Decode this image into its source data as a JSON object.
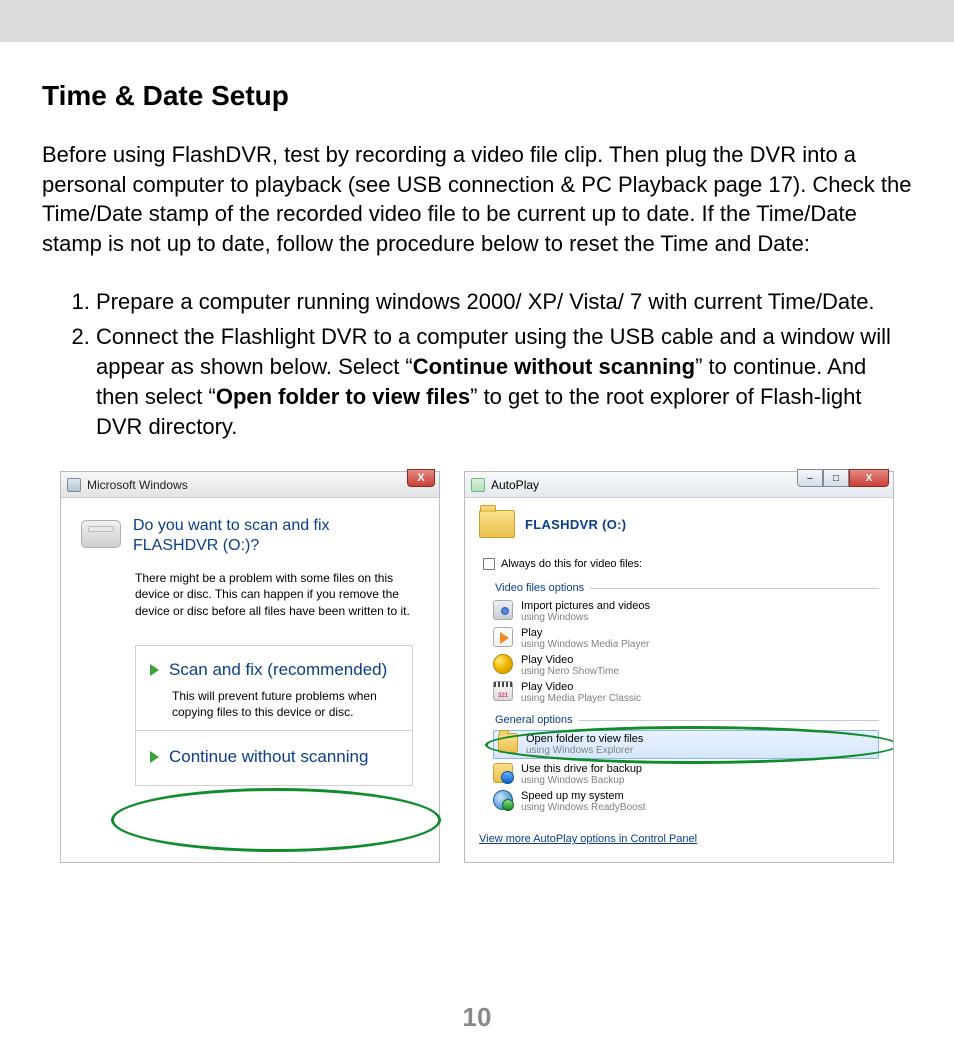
{
  "title": "Time & Date Setup",
  "intro": "Before using FlashDVR, test by recording a video file clip. Then plug the DVR into a personal computer to playback (see USB connection & PC Playback page 17).  Check the Time/Date stamp of the recorded video file to be current up to date. If the Time/Date stamp is not up to date, follow the procedure below to reset the Time and Date:",
  "steps": {
    "s1": "Prepare a computer running windows 2000/ XP/ Vista/ 7 with current Time/Date.",
    "s2_part1": "Connect the Flashlight DVR to a computer using the USB cable and a window will appear as shown below.  Select “",
    "s2_bold1": "Continue without scanning",
    "s2_part2": "” to continue. And then select “",
    "s2_bold2": "Open folder to view files",
    "s2_part3": "” to get to the root explorer of Flash-light DVR directory."
  },
  "page_number": "10",
  "dlg_left": {
    "titlebar": "Microsoft Windows",
    "close_x": "X",
    "question": "Do you want to scan and fix FLASHDVR (O:)?",
    "explain": "There might be a problem with some files on this device or disc. This can happen if you remove the device or disc before all files have been written to it.",
    "opt1_title": "Scan and fix (recommended)",
    "opt1_sub": "This will prevent future problems when copying files to this device or disc.",
    "opt2_title": "Continue without scanning"
  },
  "dlg_right": {
    "titlebar": "AutoPlay",
    "min": "–",
    "max": "□",
    "close_x": "X",
    "drive": "FLASHDVR (O:)",
    "always": "Always do this for video files:",
    "sec_video": "Video files options",
    "sec_general": "General options",
    "items_video": [
      {
        "title": "Import pictures and videos",
        "sub": "using Windows"
      },
      {
        "title": "Play",
        "sub": "using Windows Media Player"
      },
      {
        "title": "Play Video",
        "sub": "using Nero ShowTime"
      },
      {
        "title": "Play Video",
        "sub": "using Media Player Classic"
      }
    ],
    "items_general": [
      {
        "title": "Open folder to view files",
        "sub": "using Windows Explorer"
      },
      {
        "title": "Use this drive for backup",
        "sub": "using Windows Backup"
      },
      {
        "title": "Speed up my system",
        "sub": "using Windows ReadyBoost"
      }
    ],
    "view_more": "View more AutoPlay options in Control Panel"
  }
}
